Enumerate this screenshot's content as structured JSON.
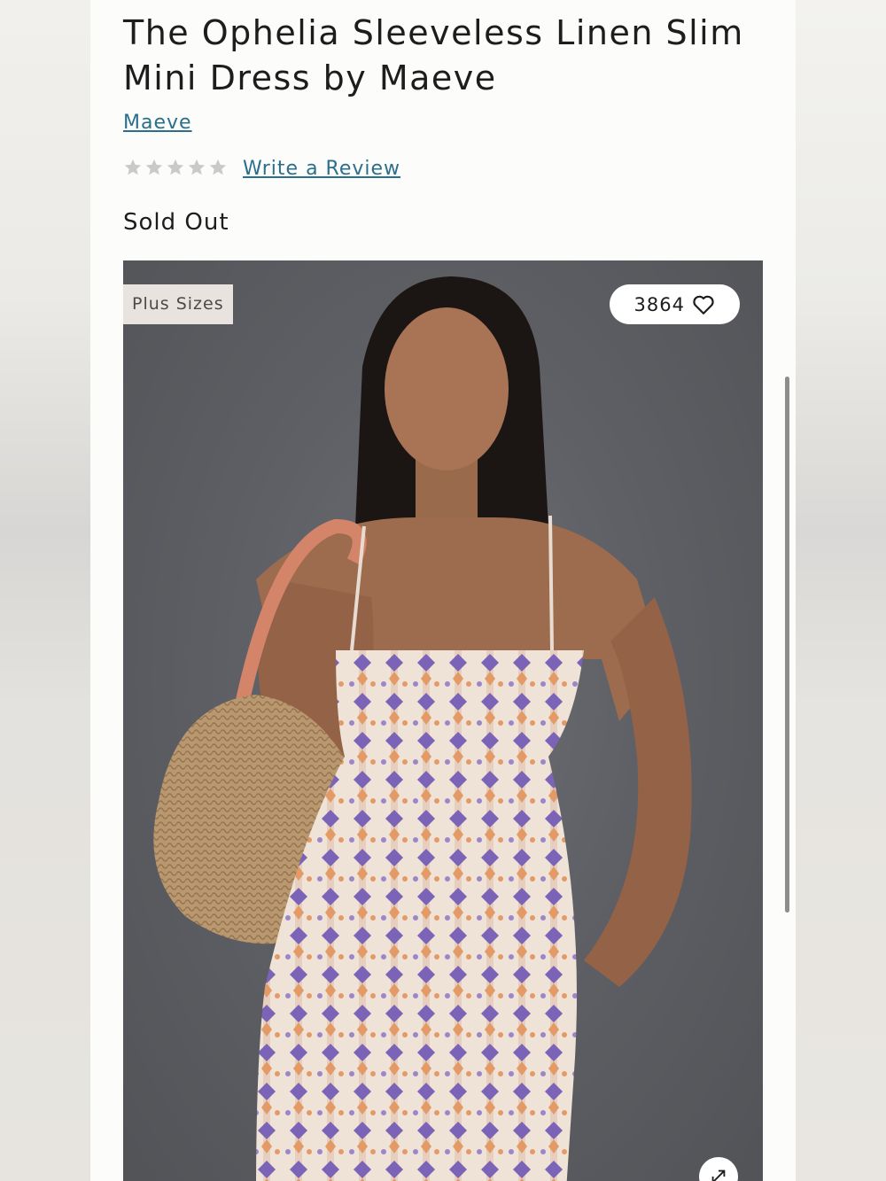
{
  "product": {
    "title": "The Ophelia Sleeveless Linen Slim Mini Dress by Maeve",
    "brand": "Maeve",
    "rating": 0,
    "rating_max": 5,
    "review_link": "Write a Review",
    "status": "Sold Out"
  },
  "gallery": {
    "badge": "Plus Sizes",
    "favorites_count": "3864",
    "favorite_icon": "heart-outline-icon",
    "expand_icon": "expand-arrows-icon"
  },
  "colors": {
    "link": "#2a6f8c",
    "star_empty": "#c9c9c9",
    "text": "#1d1d1d",
    "badge_bg": "#e8e3de"
  }
}
